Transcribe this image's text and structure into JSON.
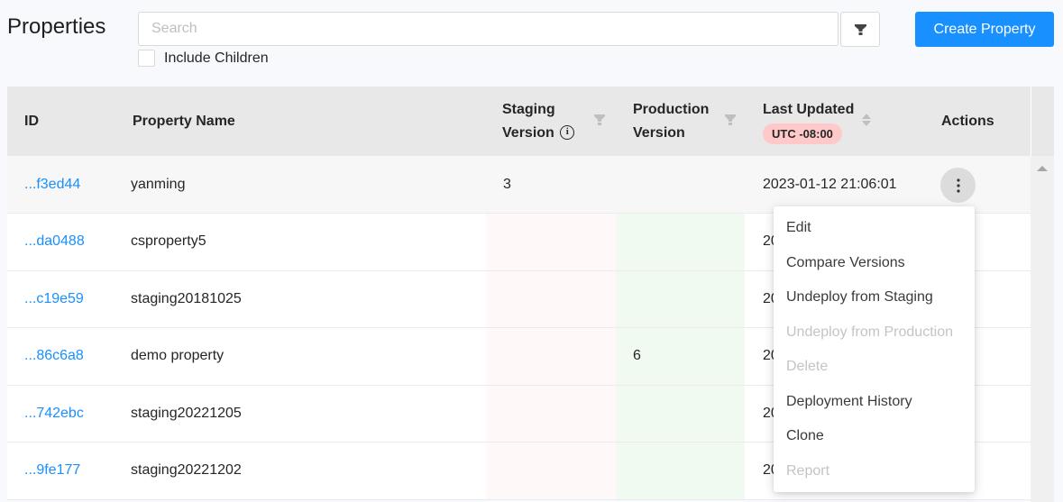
{
  "header": {
    "title": "Properties",
    "search_placeholder": "Search",
    "search_value": "",
    "include_children_label": "Include Children",
    "include_children_checked": false,
    "create_button": "Create Property"
  },
  "table": {
    "columns": {
      "id": "ID",
      "name": "Property Name",
      "staging_line1": "Staging",
      "staging_line2": "Version",
      "production_line1": "Production",
      "production_line2": "Version",
      "updated": "Last Updated",
      "timezone_badge": "UTC -08:00",
      "actions": "Actions"
    },
    "rows": [
      {
        "id": "...f3ed44",
        "name": "yanming",
        "staging": "3",
        "production": "",
        "updated": "2023-01-12 21:06:01"
      },
      {
        "id": "...da0488",
        "name": "csproperty5",
        "staging": "",
        "production": "",
        "updated": "20"
      },
      {
        "id": "...c19e59",
        "name": "staging20181025",
        "staging": "",
        "production": "",
        "updated": "20"
      },
      {
        "id": "...86c6a8",
        "name": "demo property",
        "staging": "",
        "production": "6",
        "updated": "20"
      },
      {
        "id": "...742ebc",
        "name": "staging20221205",
        "staging": "",
        "production": "",
        "updated": "20"
      },
      {
        "id": "...9fe177",
        "name": "staging20221202",
        "staging": "",
        "production": "",
        "updated": "20"
      }
    ]
  },
  "actions_menu": {
    "items": [
      {
        "label": "Edit",
        "disabled": false
      },
      {
        "label": "Compare Versions",
        "disabled": false
      },
      {
        "label": "Undeploy from Staging",
        "disabled": false
      },
      {
        "label": "Undeploy from Production",
        "disabled": true
      },
      {
        "label": "Delete",
        "disabled": true
      },
      {
        "label": "Deployment History",
        "disabled": false
      },
      {
        "label": "Clone",
        "disabled": false
      },
      {
        "label": "Report",
        "disabled": true
      }
    ]
  },
  "colors": {
    "accent": "#1890ff",
    "staging_tint": "#fff8f8",
    "production_tint": "#f1faf1",
    "timezone_badge": "#ffc9c9"
  }
}
